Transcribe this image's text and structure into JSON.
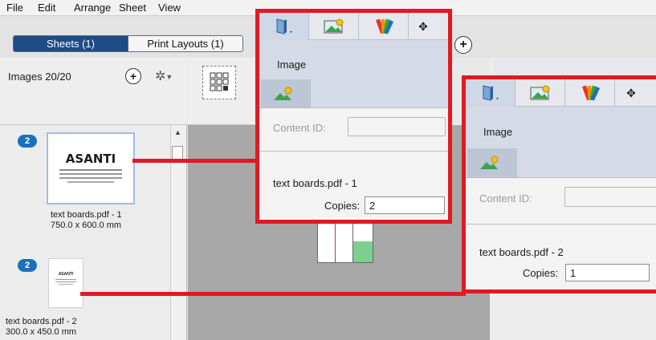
{
  "menu": [
    "File",
    "Edit",
    "Arrange",
    "Sheet",
    "View"
  ],
  "tabs": {
    "sheets": "Sheets (1)",
    "print_layouts": "Print Layouts (1)"
  },
  "images_panel": {
    "title": "Images 20/20",
    "items": [
      {
        "badge": "2",
        "thumb_title": "ASANTI",
        "name": "text boards.pdf - 1",
        "size": "750.0 x 600.0 mm"
      },
      {
        "badge": "2",
        "thumb_title": "ASANTI",
        "name": "text boards.pdf - 2",
        "size": "300.0 x 450.0 mm"
      }
    ]
  },
  "callouts": [
    {
      "section": "Image",
      "content_id_label": "Content ID:",
      "content_id_value": "",
      "file": "text boards.pdf - 1",
      "copies_label": "Copies:",
      "copies_value": "2"
    },
    {
      "section": "Image",
      "content_id_label": "Content ID:",
      "content_id_value": "",
      "file": "text boards.pdf - 2",
      "copies_label": "Copies:",
      "copies_value": "1"
    }
  ],
  "colors": {
    "accent": "#1f4b86",
    "callout_border": "#e01a22",
    "badge": "#1b6fbf",
    "canvas": "#a8a8a8"
  },
  "icons": [
    "book-icon",
    "image-icon",
    "color-palette-icon",
    "move-icon",
    "plus-icon",
    "gear-icon",
    "grid-icon"
  ]
}
